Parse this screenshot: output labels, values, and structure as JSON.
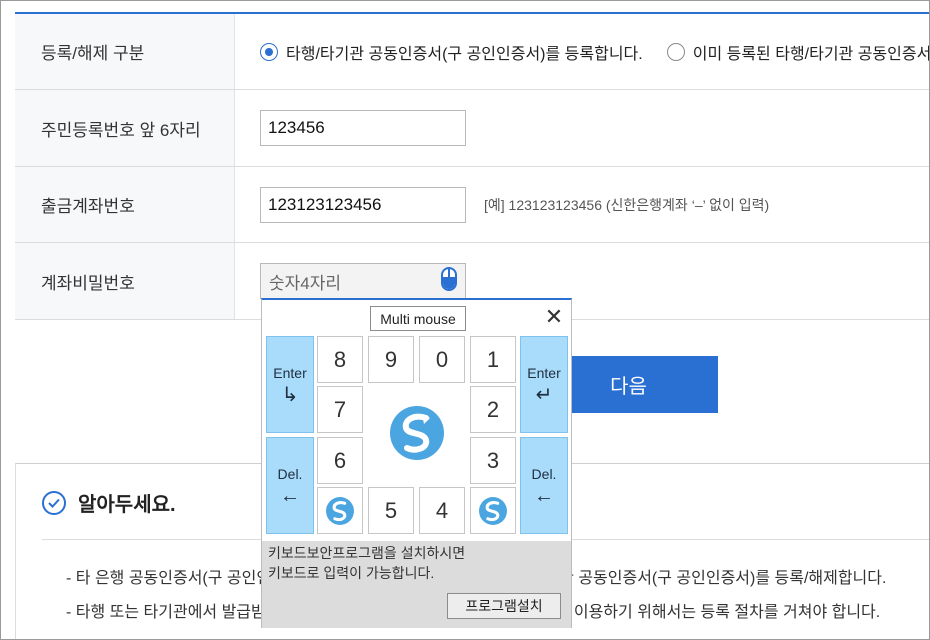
{
  "form": {
    "row1": {
      "label": "등록/해제 구분",
      "option1": "타행/타기관 공동인증서(구 공인인증서)를 등록합니다.",
      "option2": "이미 등록된 타행/타기관 공동인증서(구 공인인증서)를 해제합니다."
    },
    "row2": {
      "label": "주민등록번호 앞 6자리",
      "value": "123456"
    },
    "row3": {
      "label": "출금계좌번호",
      "value": "123123123456",
      "hint": "[예] 123123123456 (신한은행계좌 ‘–’ 없이 입력)"
    },
    "row4": {
      "label": "계좌비밀번호",
      "placeholder": "숫자4자리"
    }
  },
  "next_label": "다음",
  "keypad": {
    "multi_mouse": "Multi mouse",
    "close": "✕",
    "enter": "Enter",
    "del": "Del.",
    "enter_arrow": "↳",
    "enter_arrow_right": "↵",
    "del_arrow": "←",
    "keys": {
      "k8": "8",
      "k9": "9",
      "k0": "0",
      "k1": "1",
      "k7": "7",
      "k2": "2",
      "k6": "6",
      "k3": "3",
      "k5": "5",
      "k4": "4"
    },
    "msg1": "키보드보안프로그램을 설치하시면",
    "msg2": "키보드로 입력이 가능합니다.",
    "install": "프로그램설치"
  },
  "notice": {
    "title": "알아두세요.",
    "item1": "- 타 은행 공동인증서(구 공인인증서)를 신한은행에서 이용하려면 타행/타기관 공동인증서(구 공인인증서)를 등록/해제합니다.",
    "item2": "- 타행 또는 타기관에서 발급받은 공동인증서(구 공인인증서)를 신한은행에서 이용하기 위해서는 등록 절차를 거쳐야 합니다."
  },
  "colors": {
    "accent": "#2a6fd2",
    "key_side": "#a9dbfb"
  }
}
